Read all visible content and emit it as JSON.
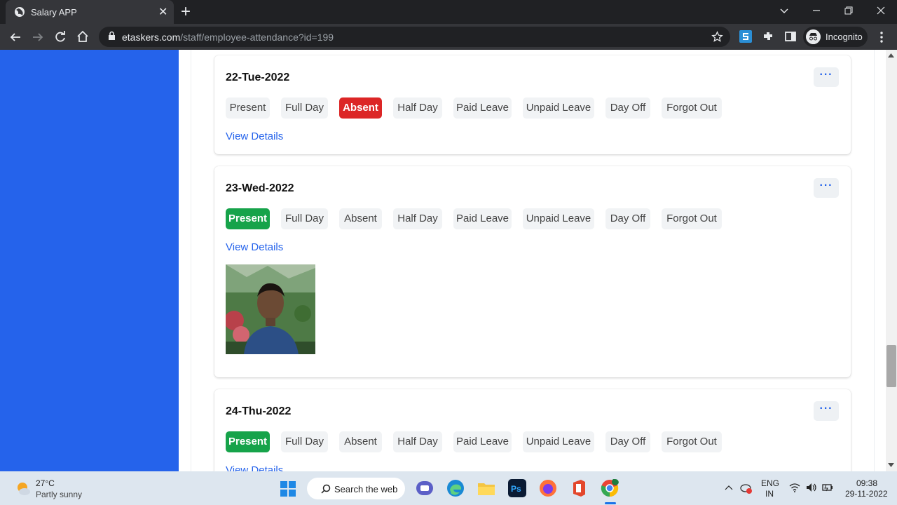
{
  "browser": {
    "tab_title": "Salary APP",
    "tab_close": "✕",
    "new_tab": "+",
    "url_domain": "etaskers.com",
    "url_path": "/staff/employee-attendance?id=199",
    "incognito_label": "Incognito",
    "accent": "#2563eb"
  },
  "attendance": {
    "options": [
      "Present",
      "Full Day",
      "Absent",
      "Half Day",
      "Paid Leave",
      "Unpaid Leave",
      "Day Off",
      "Forgot Out"
    ],
    "view_details": "View Details",
    "more": "···",
    "days": [
      {
        "date": "22-Tue-2022",
        "selected": "Absent"
      },
      {
        "date": "23-Wed-2022",
        "selected": "Present",
        "has_photo": true
      },
      {
        "date": "24-Thu-2022",
        "selected": "Present"
      }
    ],
    "colors": {
      "present": "#16a34a",
      "absent": "#dc2626"
    }
  },
  "taskbar": {
    "weather_temp": "27°C",
    "weather_desc": "Partly sunny",
    "search_label": "Search the web",
    "lang1": "ENG",
    "lang2": "IN",
    "time": "09:38",
    "date": "29-11-2022"
  }
}
